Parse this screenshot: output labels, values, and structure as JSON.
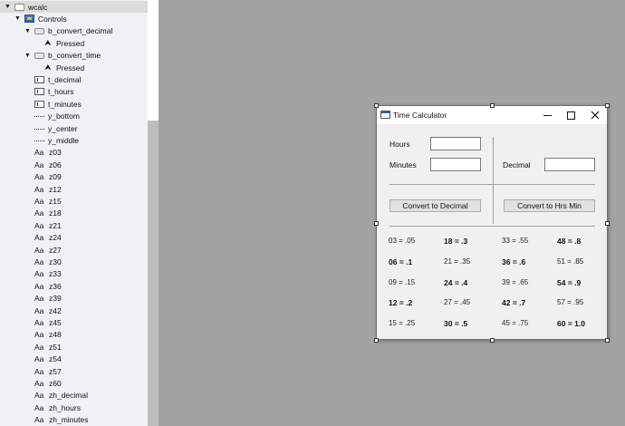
{
  "tree": {
    "items": [
      {
        "label": "wcalc",
        "icon": "window-icon",
        "indent": 0,
        "expander": "▼",
        "selected": true
      },
      {
        "label": "Controls",
        "icon": "controls-icon",
        "indent": 1,
        "expander": "▼"
      },
      {
        "label": "b_convert_decimal",
        "icon": "button-icon",
        "indent": 2,
        "expander": "▼"
      },
      {
        "label": "Pressed",
        "icon": "cursor-icon",
        "indent": 3,
        "expander": ""
      },
      {
        "label": "b_convert_time",
        "icon": "button-icon",
        "indent": 2,
        "expander": "▼"
      },
      {
        "label": "Pressed",
        "icon": "cursor-icon",
        "indent": 3,
        "expander": ""
      },
      {
        "label": "t_decimal",
        "icon": "textfield-icon",
        "indent": 2,
        "expander": ""
      },
      {
        "label": "t_hours",
        "icon": "textfield-icon",
        "indent": 2,
        "expander": ""
      },
      {
        "label": "t_minutes",
        "icon": "textfield-icon",
        "indent": 2,
        "expander": ""
      },
      {
        "label": "y_bottom",
        "icon": "line-icon",
        "indent": 2,
        "expander": ""
      },
      {
        "label": "y_center",
        "icon": "line-icon",
        "indent": 2,
        "expander": ""
      },
      {
        "label": "y_middle",
        "icon": "line-icon",
        "indent": 2,
        "expander": ""
      },
      {
        "label": "z03",
        "icon": "label-icon",
        "indent": 2,
        "expander": ""
      },
      {
        "label": "z06",
        "icon": "label-icon",
        "indent": 2,
        "expander": ""
      },
      {
        "label": "z09",
        "icon": "label-icon",
        "indent": 2,
        "expander": ""
      },
      {
        "label": "z12",
        "icon": "label-icon",
        "indent": 2,
        "expander": ""
      },
      {
        "label": "z15",
        "icon": "label-icon",
        "indent": 2,
        "expander": ""
      },
      {
        "label": "z18",
        "icon": "label-icon",
        "indent": 2,
        "expander": ""
      },
      {
        "label": "z21",
        "icon": "label-icon",
        "indent": 2,
        "expander": ""
      },
      {
        "label": "z24",
        "icon": "label-icon",
        "indent": 2,
        "expander": ""
      },
      {
        "label": "z27",
        "icon": "label-icon",
        "indent": 2,
        "expander": ""
      },
      {
        "label": "z30",
        "icon": "label-icon",
        "indent": 2,
        "expander": ""
      },
      {
        "label": "z33",
        "icon": "label-icon",
        "indent": 2,
        "expander": ""
      },
      {
        "label": "z36",
        "icon": "label-icon",
        "indent": 2,
        "expander": ""
      },
      {
        "label": "z39",
        "icon": "label-icon",
        "indent": 2,
        "expander": ""
      },
      {
        "label": "z42",
        "icon": "label-icon",
        "indent": 2,
        "expander": ""
      },
      {
        "label": "z45",
        "icon": "label-icon",
        "indent": 2,
        "expander": ""
      },
      {
        "label": "z48",
        "icon": "label-icon",
        "indent": 2,
        "expander": ""
      },
      {
        "label": "z51",
        "icon": "label-icon",
        "indent": 2,
        "expander": ""
      },
      {
        "label": "z54",
        "icon": "label-icon",
        "indent": 2,
        "expander": ""
      },
      {
        "label": "z57",
        "icon": "label-icon",
        "indent": 2,
        "expander": ""
      },
      {
        "label": "z60",
        "icon": "label-icon",
        "indent": 2,
        "expander": ""
      },
      {
        "label": "zh_decimal",
        "icon": "label-icon",
        "indent": 2,
        "expander": ""
      },
      {
        "label": "zh_hours",
        "icon": "label-icon",
        "indent": 2,
        "expander": ""
      },
      {
        "label": "zh_minutes",
        "icon": "label-icon",
        "indent": 2,
        "expander": ""
      }
    ]
  },
  "window": {
    "title": "Time Calculator",
    "hours_label": "Hours",
    "minutes_label": "Minutes",
    "decimal_label": "Decimal",
    "hours_value": "",
    "minutes_value": "",
    "decimal_value": "",
    "convert_decimal_label": "Convert to Decimal",
    "convert_time_label": "Convert to Hrs Min",
    "table": [
      [
        "03 = .05",
        "18 = .3",
        "33 = .55",
        "48 = .8"
      ],
      [
        "06 = .1",
        "21 = .35",
        "36 = .6",
        "51 = .85"
      ],
      [
        "09 = .15",
        "24 = .4",
        "39 = .65",
        "54 = .9"
      ],
      [
        "12 = .2",
        "27 = .45",
        "42 = .7",
        "57 = .95"
      ],
      [
        "15 = .25",
        "30 = .5",
        "45 = .75",
        "60 = 1.0"
      ]
    ],
    "bold_cells": [
      "18 = .3",
      "48 = .8",
      "06 = .1",
      "36 = .6",
      "24 = .4",
      "54 = .9",
      "12 = .2",
      "42 = .7",
      "30 = .5",
      "60 = 1.0"
    ]
  }
}
